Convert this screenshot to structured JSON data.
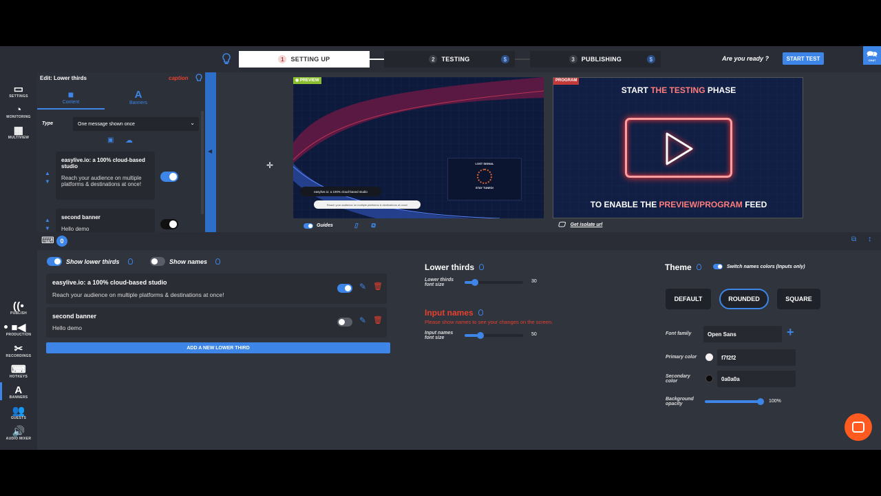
{
  "topbar": {
    "steps": [
      {
        "num": "1",
        "label": "SETTING UP"
      },
      {
        "num": "2",
        "label": "TESTING",
        "badge": "$"
      },
      {
        "num": "3",
        "label": "PUBLISHING",
        "badge": "$"
      }
    ],
    "ready_text": "Are you ready ?",
    "start_test_label": "START TEST",
    "chat_label": "CHAT"
  },
  "leftnav": {
    "items": [
      "SETTINGS",
      "MONITORING",
      "MULTIVIEW",
      "PUBLISH",
      "PRODUCTION",
      "RECORDINGS",
      "HOTKEYS",
      "BANNERS",
      "GUESTS",
      "AUDIO MIXER"
    ]
  },
  "editor": {
    "title": "Edit: Lower thirds",
    "brand": "caption",
    "tabs": [
      {
        "label": "Content"
      },
      {
        "label": "Banners"
      }
    ],
    "type_label": "Type",
    "type_value": "One message shown once",
    "banners": [
      {
        "title": "easylive.io: a 100% cloud-based studio",
        "body": "Reach your audience on multiple platforms & destinations at once!"
      },
      {
        "title": "second banner",
        "body": "Hello demo"
      }
    ]
  },
  "preview": {
    "tag": "PREVIEW",
    "lower_third_title": "easylive.io: a 100% cloud-based studio",
    "lower_third_body": "Reach your audience on multiple platforms & destinations at once!",
    "lost_signal": "LOST SIGNAL",
    "stay_tuned": "STAY TUNED!",
    "guides_label": "Guides"
  },
  "program": {
    "tag": "PROGRAM",
    "line1_a": "START ",
    "line1_b": "THE TESTING",
    "line1_c": " PHASE",
    "line2_a": "TO ENABLE THE ",
    "line2_b": "PREVIEW/PROGRAM",
    "line2_c": " FEED",
    "isolate_label": "Get isolate url"
  },
  "toolbar": {
    "counter": "0"
  },
  "lower_thirds": {
    "show_label": "Show lower thirds",
    "show_names_label": "Show names",
    "rows": [
      {
        "title": "easylive.io: a 100% cloud-based studio",
        "body": "Reach your audience on multiple platforms & destinations at once!",
        "enabled": true
      },
      {
        "title": "second banner",
        "body": "Hello demo",
        "enabled": false
      }
    ],
    "add_label": "ADD A NEW LOWER THIRD"
  },
  "settings": {
    "lower_thirds_heading": "Lower thirds",
    "lt_font_label": "Lower thirds font size",
    "lt_font_value": "30",
    "input_names_heading": "Input names",
    "input_names_warning": "Please show names to see your changes on the screen.",
    "in_font_label": "Input names font size",
    "in_font_value": "50"
  },
  "theme": {
    "heading": "Theme",
    "switch_label": "Switch names colors (Inputs only)",
    "buttons": [
      "DEFAULT",
      "ROUNDED",
      "SQUARE"
    ],
    "selected": "ROUNDED",
    "font_family_label": "Font family",
    "font_family_value": "Open Sans",
    "primary_label": "Primary color",
    "primary_value": "f7f2f2",
    "secondary_label": "Secondary color",
    "secondary_value": "0a0a0a",
    "bg_opacity_label": "Background opacity",
    "bg_opacity_value": "100%"
  },
  "colors": {
    "accent": "#3d86e8",
    "brand_red": "#e8402e",
    "preview_green": "#8bbf2f",
    "program_red": "#c23a3a"
  }
}
